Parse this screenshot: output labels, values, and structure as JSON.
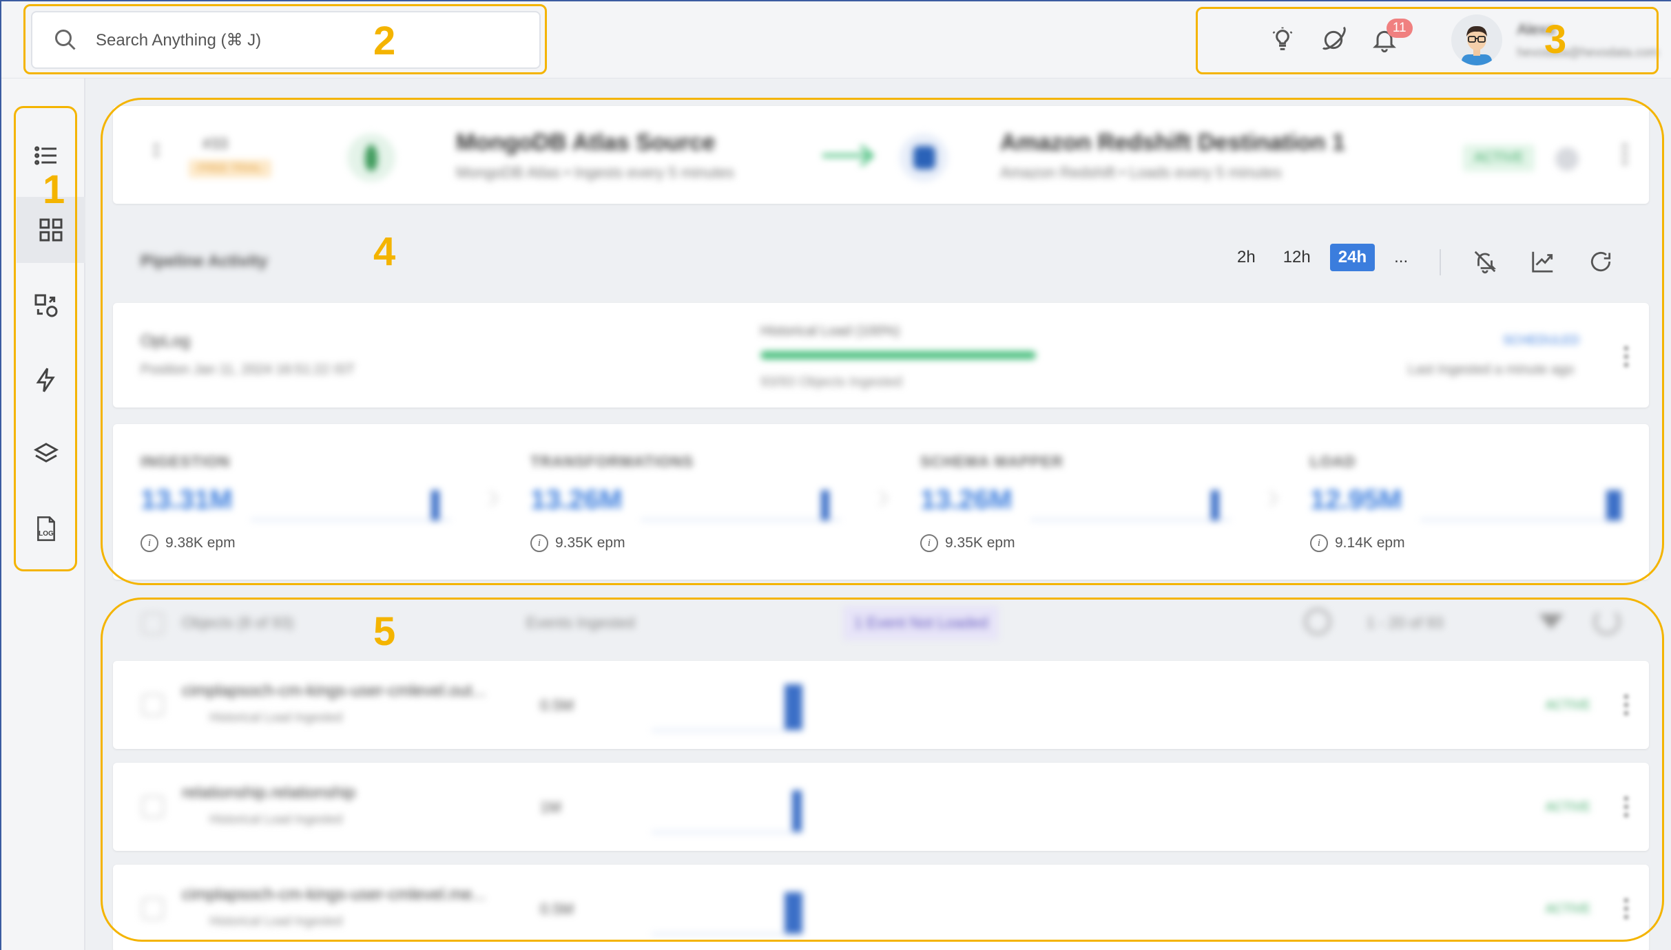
{
  "search": {
    "placeholder": "Search Anything  (⌘ J)"
  },
  "topbar": {
    "notification_count": "11",
    "user": {
      "name": "Alexa",
      "email": "hevodata@hevodata.com"
    }
  },
  "sidebar": {
    "items": [
      {
        "icon": "list-icon"
      },
      {
        "icon": "grid-icon",
        "active": true
      },
      {
        "icon": "transform-icon"
      },
      {
        "icon": "bolt-icon"
      },
      {
        "icon": "layers-icon"
      },
      {
        "icon": "log-icon",
        "label": "LOG"
      }
    ]
  },
  "pipeline": {
    "number": "#33",
    "trial_badge": "FREE TRIAL",
    "source": {
      "name": "MongoDB Atlas Source",
      "sub": "MongoDB Atlas • Ingests every 5 minutes"
    },
    "destination": {
      "name": "Amazon Redshift Destination 1",
      "sub": "Amazon Redshift • Loads every 5 minutes"
    },
    "status": "ACTIVE"
  },
  "activity": {
    "title": "Pipeline Activity",
    "ranges": [
      "2h",
      "12h",
      "24h",
      "..."
    ],
    "active_range": "24h"
  },
  "oplog": {
    "name": "OpLog",
    "position": "Position Jan 11, 2024 16:51:22 IST",
    "historical": "Historical Load (100%)",
    "progress": 1.0,
    "objects_ingested": "93/93 Objects Ingested",
    "schedule": "SCHEDULED",
    "last_ingested": "Last Ingested a minute ago"
  },
  "stages": [
    {
      "title": "INGESTION",
      "value": "13.31M",
      "epm": "9.38K epm"
    },
    {
      "title": "TRANSFORMATIONS",
      "value": "13.26M",
      "epm": "9.35K epm"
    },
    {
      "title": "SCHEMA MAPPER",
      "value": "13.26M",
      "epm": "9.35K epm"
    },
    {
      "title": "LOAD",
      "value": "12.95M",
      "epm": "9.14K epm"
    }
  ],
  "objects": {
    "header": {
      "title": "Objects (8 of 93)",
      "events_col": "Events Ingested",
      "not_loaded": "1 Event Not Loaded",
      "pagination": "1 - 20 of 93"
    },
    "rows": [
      {
        "name": "cimplapsoch-cm-kings-user-cmlevel.out...",
        "sub": "Historical Load Ingested",
        "count": "0.5M",
        "status": "ACTIVE"
      },
      {
        "name": "relationship.relationship",
        "sub": "Historical Load Ingested",
        "count": "1M",
        "status": "ACTIVE"
      },
      {
        "name": "cimplapsoch-cm-kings-user-cmlevel.me...",
        "sub": "Historical Load Ingested",
        "count": "0.5M",
        "status": "ACTIVE"
      }
    ]
  },
  "annotations": [
    "1",
    "2",
    "3",
    "4",
    "5"
  ],
  "colors": {
    "accent": "#3b7ddd",
    "annotation": "#f4b400",
    "active_green": "#3aa863"
  }
}
